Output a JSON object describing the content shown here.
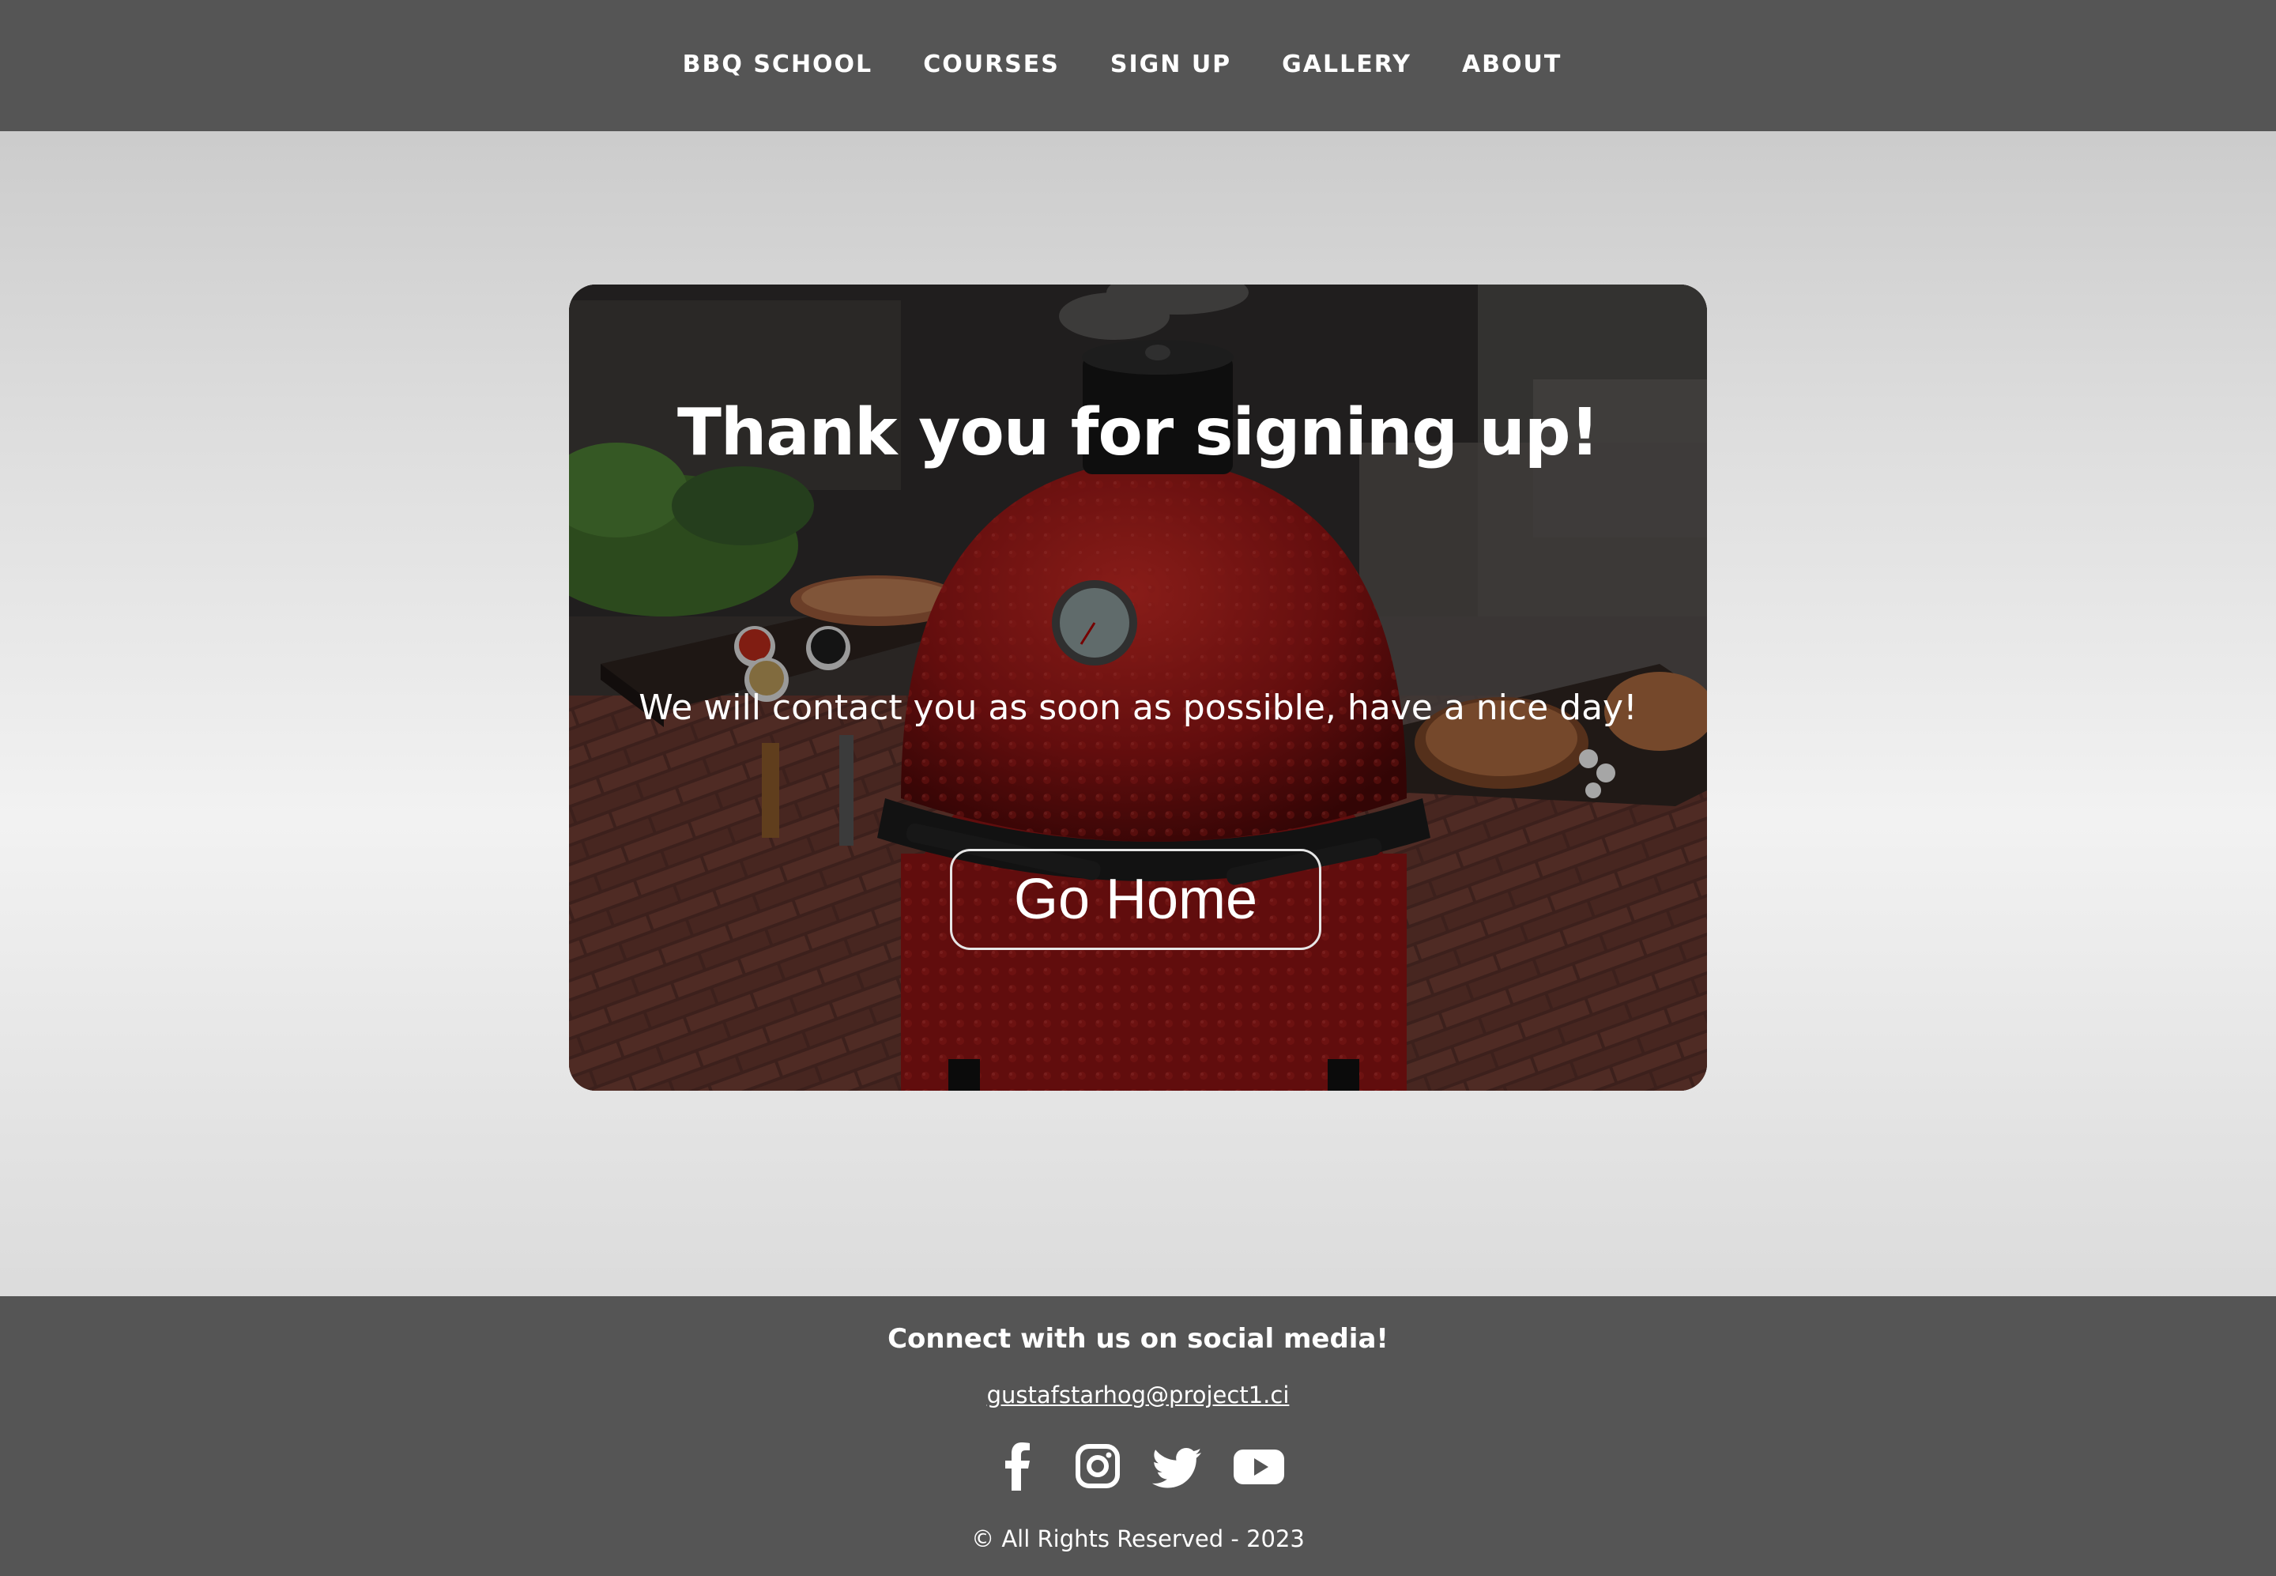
{
  "nav": {
    "items": [
      {
        "label": "BBQ SCHOOL"
      },
      {
        "label": "COURSES"
      },
      {
        "label": "SIGN UP"
      },
      {
        "label": "GALLERY"
      },
      {
        "label": "ABOUT"
      }
    ]
  },
  "hero": {
    "title": "Thank you for signing up!",
    "message": "We will contact you as soon as possible, have a nice day!",
    "button_label": "Go Home",
    "background_image": "kamado-grill-photo"
  },
  "footer": {
    "connect_text": "Connect with us on social media!",
    "email": "gustafstarhog@project1.ci",
    "social_icons": [
      "facebook-icon",
      "instagram-icon",
      "twitter-icon",
      "youtube-icon"
    ],
    "copyright": "© All Rights Reserved - 2023"
  },
  "colors": {
    "header_bg": "#555555",
    "footer_bg": "#555555",
    "grill_red": "#a51818",
    "text": "#ffffff"
  }
}
